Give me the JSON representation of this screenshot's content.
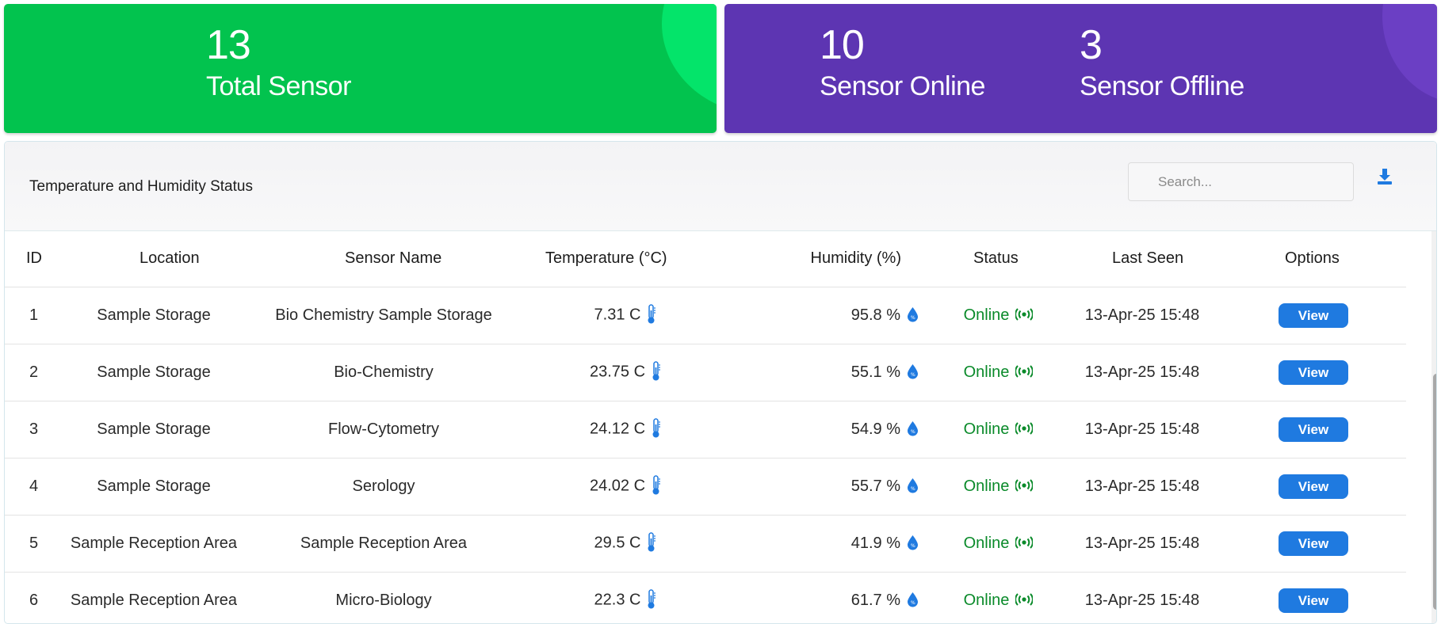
{
  "stats": {
    "total": {
      "value": "13",
      "label": "Total Sensor"
    },
    "online": {
      "value": "10",
      "label": "Sensor Online"
    },
    "offline": {
      "value": "3",
      "label": "Sensor Offline"
    }
  },
  "panel": {
    "title": "Temperature and Humidity Status",
    "search_placeholder": "Search..."
  },
  "table": {
    "headers": [
      "ID",
      "Location",
      "Sensor Name",
      "Temperature (°C)",
      "Humidity (%)",
      "Status",
      "Last Seen",
      "Options"
    ],
    "rows": [
      {
        "id": "1",
        "location": "Sample Storage",
        "sensor": "Bio Chemistry Sample Storage",
        "temp": "7.31 C",
        "humidity": "95.8 %",
        "status": "Online",
        "last_seen": "13-Apr-25 15:48",
        "option": "View"
      },
      {
        "id": "2",
        "location": "Sample Storage",
        "sensor": "Bio-Chemistry",
        "temp": "23.75 C",
        "humidity": "55.1 %",
        "status": "Online",
        "last_seen": "13-Apr-25 15:48",
        "option": "View"
      },
      {
        "id": "3",
        "location": "Sample Storage",
        "sensor": "Flow-Cytometry",
        "temp": "24.12 C",
        "humidity": "54.9 %",
        "status": "Online",
        "last_seen": "13-Apr-25 15:48",
        "option": "View"
      },
      {
        "id": "4",
        "location": "Sample Storage",
        "sensor": "Serology",
        "temp": "24.02 C",
        "humidity": "55.7 %",
        "status": "Online",
        "last_seen": "13-Apr-25 15:48",
        "option": "View"
      },
      {
        "id": "5",
        "location": "Sample Reception Area",
        "sensor": "Sample Reception Area",
        "temp": "29.5 C",
        "humidity": "41.9 %",
        "status": "Online",
        "last_seen": "13-Apr-25 15:48",
        "option": "View"
      },
      {
        "id": "6",
        "location": "Sample Reception Area",
        "sensor": "Micro-Biology",
        "temp": "22.3 C",
        "humidity": "61.7 %",
        "status": "Online",
        "last_seen": "13-Apr-25 15:48",
        "option": "View"
      }
    ]
  },
  "icons": {
    "temperature": "thermometer-icon",
    "humidity": "water-drop-icon",
    "status": "signal-icon",
    "download": "download-icon"
  },
  "colors": {
    "total_card": "#02c34e",
    "status_card": "#5d35b2",
    "online_text": "#0a8a2a",
    "view_button": "#1f7ae0",
    "icon_blue": "#1f7ae0"
  }
}
